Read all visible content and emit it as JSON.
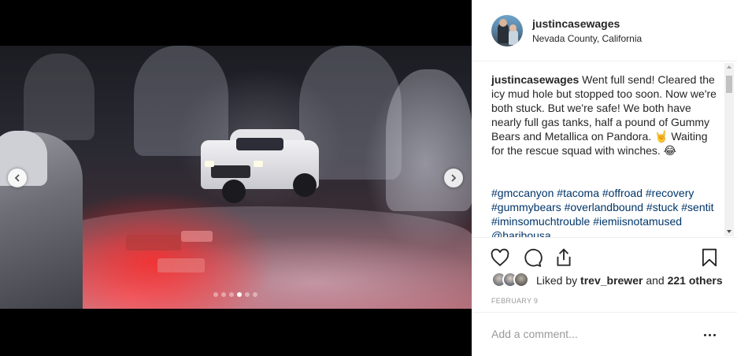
{
  "post": {
    "username": "justincasewages",
    "location": "Nevada County, California",
    "caption_user": "justincasewages",
    "caption_text": "Went full send! Cleared the icy mud hole but stopped too soon. Now we're both stuck. But we're safe! We both have nearly full gas tanks, half a pound of Gummy Bears and Metallica on Pandora. 🤘 Waiting for the rescue squad with winches. 😂",
    "hashtags": [
      "#gmccanyon",
      "#tacoma",
      "#offroad",
      "#recovery",
      "#gummybears",
      "#overlandbound",
      "#stuck",
      "#sentit",
      "#iminsomuchtrouble",
      "#iemiisnotamused",
      "@haribousa"
    ],
    "likes_prefix": "Liked by",
    "liked_by": "trev_brewer",
    "likes_connector": "and",
    "likes_count": "221 others",
    "date": "FEBRUARY 9"
  },
  "comment": {
    "placeholder": "Add a comment..."
  },
  "carousel": {
    "slide_count": 6,
    "active_index": 3
  },
  "colors": {
    "link": "#003569",
    "text": "#262626",
    "muted": "#999999",
    "border": "#efefef"
  },
  "icons": {
    "like": "heart-icon",
    "comment": "comment-icon",
    "share": "share-icon",
    "save": "bookmark-icon",
    "prev": "chevron-left-icon",
    "next": "chevron-right-icon",
    "more": "more-options-icon"
  }
}
